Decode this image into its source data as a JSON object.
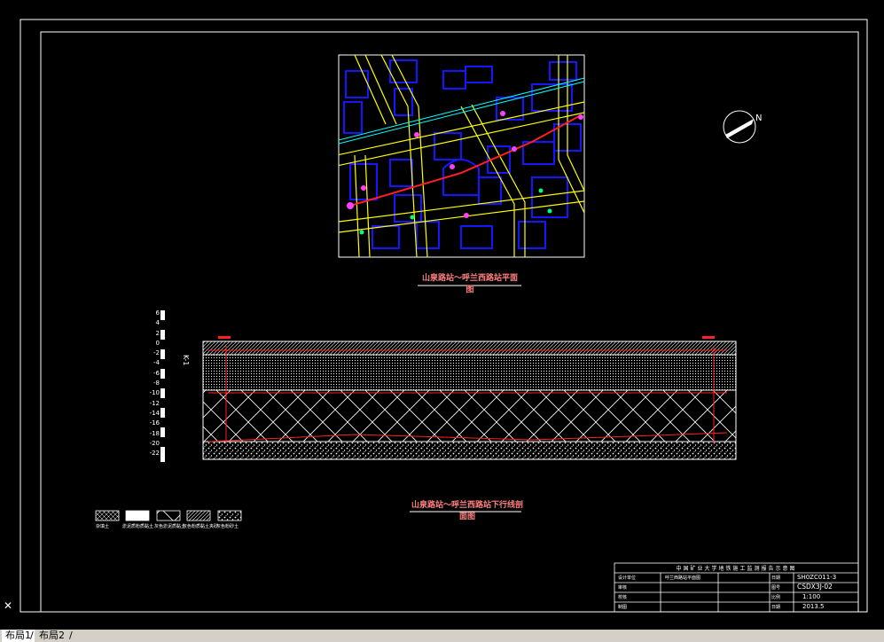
{
  "layout_tabs": [
    {
      "label": "布局1",
      "active": true
    },
    {
      "label": "布局2",
      "active": false
    }
  ],
  "plan": {
    "title": "山泉路站～呼兰西路站平面图"
  },
  "section": {
    "title": "山泉路站～呼兰西路站下行线剖面图",
    "elevation_labels": [
      "6",
      "4",
      "2",
      "0",
      "-2",
      "-4",
      "-6",
      "-8",
      "-10",
      "-12",
      "-14",
      "-16",
      "-18",
      "-20",
      "-22"
    ]
  },
  "legend": {
    "items": [
      {
        "label": "杂填土"
      },
      {
        "label": "淤泥质粉质黏土"
      },
      {
        "label": "灰色淤泥质黏土"
      },
      {
        "label": "灰色粉质黏土夹砂"
      },
      {
        "label": "灰色粉砂土"
      }
    ]
  },
  "title_block": {
    "header": "中国矿业大学地铁施工监测报告示意图",
    "code": "SH0ZC011-3",
    "drawing_no": "CSDX3J-02",
    "scale": "1:100",
    "date": "2013.5",
    "rows": [
      {
        "c1": "设计单位",
        "c2": "呼兰西路站平面图",
        "c3": "日期"
      },
      {
        "c1": "审核",
        "c2": "",
        "c3": "图号"
      },
      {
        "c1": "校核",
        "c2": "",
        "c3": "比例"
      },
      {
        "c1": "制图",
        "c2": "",
        "c3": "日期"
      }
    ]
  },
  "colors": {
    "background": "#000000",
    "frame": "#ffffff",
    "road": "#ffff00",
    "building": "#1515ff",
    "railway": "#00ffff",
    "tunnel_line": "#ff2020",
    "title_text": "#ff8080"
  }
}
